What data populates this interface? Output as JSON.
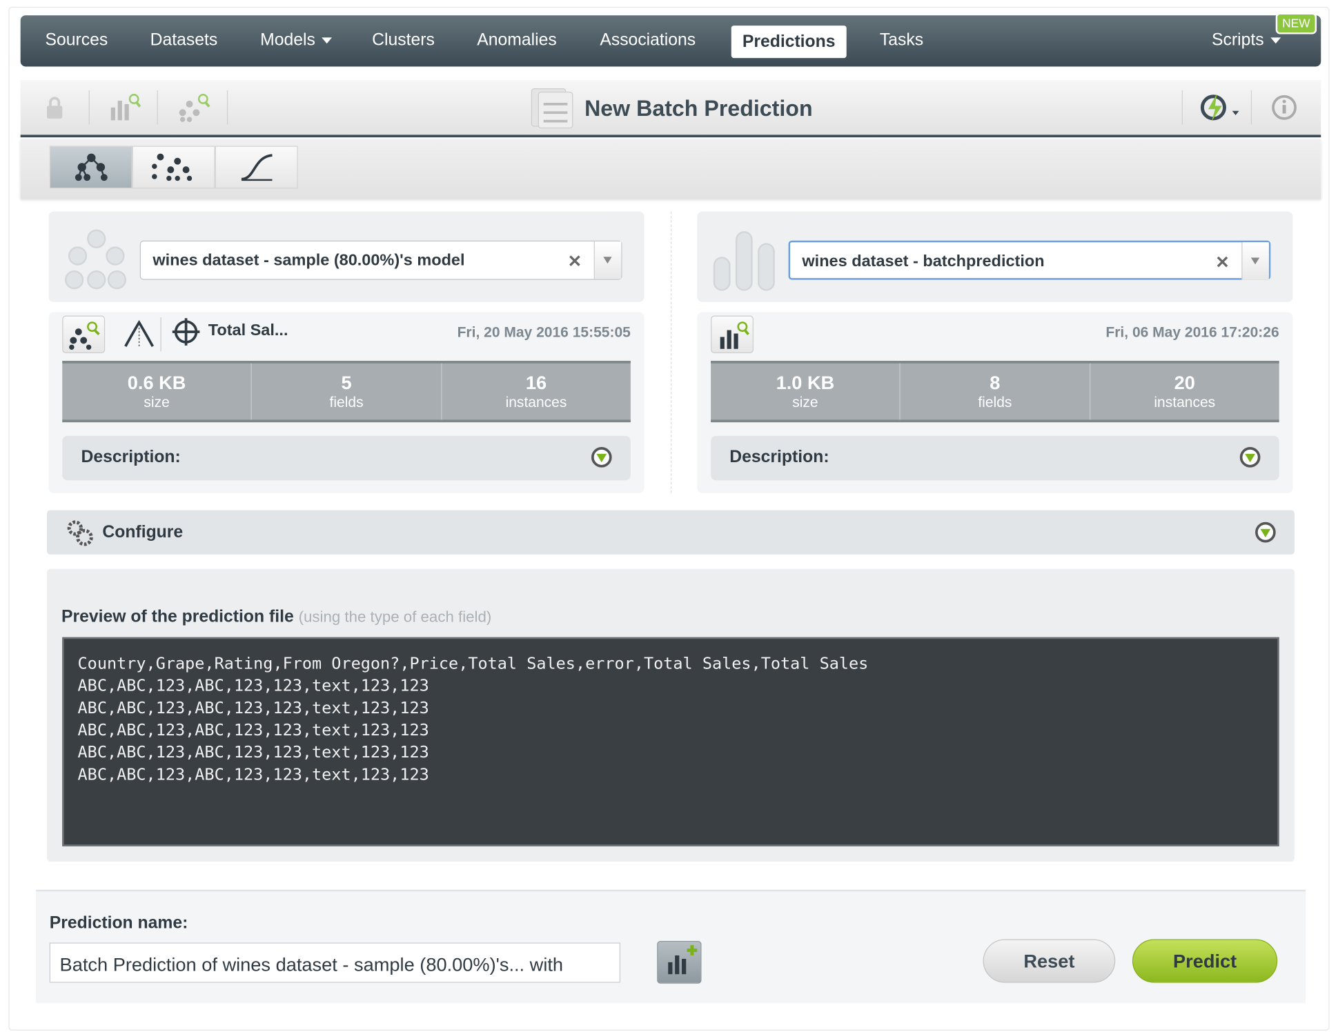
{
  "nav": {
    "items": [
      "Sources",
      "Datasets",
      "Models",
      "Clusters",
      "Anomalies",
      "Associations",
      "Predictions",
      "Tasks"
    ],
    "active": "Predictions",
    "scripts": "Scripts",
    "new_badge": "NEW"
  },
  "toolbar": {
    "title": "New Batch Prediction"
  },
  "model": {
    "selected": "wines dataset - sample (80.00%)'s model",
    "objective": "Total Sal...",
    "date": "Fri, 20 May 2016 15:55:05",
    "size": "0.6 KB",
    "size_label": "size",
    "fields": "5",
    "fields_label": "fields",
    "instances": "16",
    "instances_label": "instances",
    "description": "Description:"
  },
  "dataset": {
    "selected": "wines dataset - batchprediction",
    "date": "Fri, 06 May 2016 17:20:26",
    "size": "1.0 KB",
    "size_label": "size",
    "fields": "8",
    "fields_label": "fields",
    "instances": "20",
    "instances_label": "instances",
    "description": "Description:"
  },
  "configure": {
    "label": "Configure"
  },
  "preview": {
    "label": "Preview of the prediction file",
    "hint": "(using the type of each field)",
    "lines": [
      "Country,Grape,Rating,From Oregon?,Price,Total Sales,error,Total Sales,Total Sales",
      "ABC,ABC,123,ABC,123,123,text,123,123",
      "ABC,ABC,123,ABC,123,123,text,123,123",
      "ABC,ABC,123,ABC,123,123,text,123,123",
      "ABC,ABC,123,ABC,123,123,text,123,123",
      "ABC,ABC,123,ABC,123,123,text,123,123"
    ]
  },
  "footer": {
    "name_label": "Prediction name:",
    "name_value": "Batch Prediction of wines dataset - sample (80.00%)'s... with",
    "reset": "Reset",
    "predict": "Predict"
  },
  "colors": {
    "accent": "#8cc63f",
    "nav": "#3b4a54",
    "code_bg": "#3a3f44"
  }
}
